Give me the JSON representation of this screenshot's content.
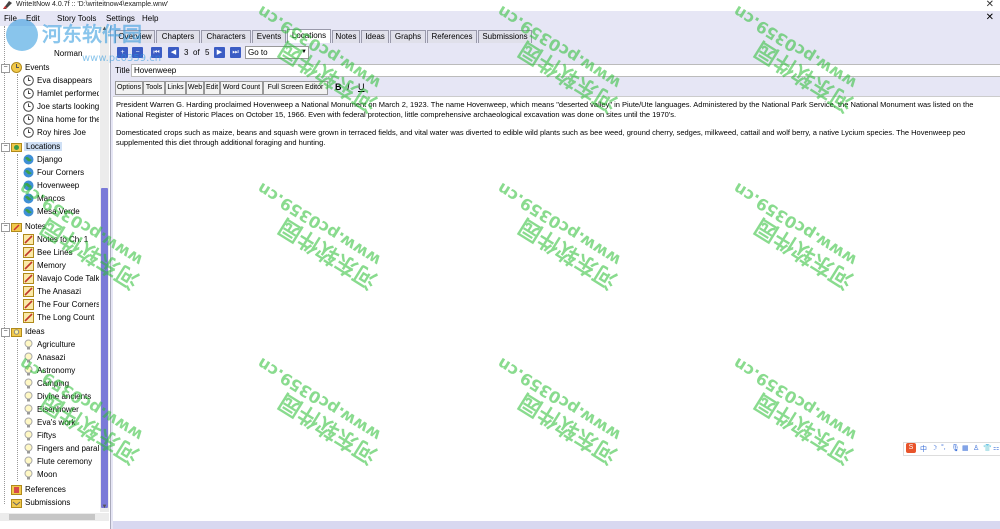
{
  "window": {
    "title": "WriteItNow 4.0.7f :: 'D:\\writeitnow4\\example.wnw'"
  },
  "menu": {
    "items": [
      "File",
      "Edit",
      "Story Tools",
      "Settings",
      "Help"
    ]
  },
  "tree": {
    "partial_top_label": "Norman",
    "events_label": "Events",
    "events": [
      "Eva disappears",
      "Hamlet performed",
      "Joe starts looking",
      "Nina home for the",
      "Roy hires Joe"
    ],
    "locations_label": "Locations",
    "locations": [
      "Django",
      "Four Corners",
      "Hovenweep",
      "Mancos",
      "Mesa Verde"
    ],
    "notes_label": "Notes",
    "notes": [
      "Notes to Ch. 1",
      "Bee Lines",
      "Memory",
      "Navajo Code Talke",
      "The Anasazi",
      "The Four Corners",
      "The Long Count"
    ],
    "ideas_label": "Ideas",
    "ideas": [
      "Agriculture",
      "Anasazi",
      "Astronomy",
      "Camping",
      "Divine ancients",
      "Eisenhower",
      "Eva's work",
      "Fiftys",
      "Fingers and paral",
      "Flute ceremony",
      "Moon"
    ],
    "references_label": "References",
    "submissions_label": "Submissions"
  },
  "tabs": [
    "Overview",
    "Chapters",
    "Characters",
    "Events",
    "Locations",
    "Notes",
    "Ideas",
    "Graphs",
    "References",
    "Submissions"
  ],
  "active_tab": "Locations",
  "nav": {
    "current": "3",
    "of_label": "of",
    "total": "5",
    "goto_label": "Go to"
  },
  "record": {
    "title_label": "Title",
    "title_value": "Hovenweep"
  },
  "toolbar": {
    "buttons": [
      "Options",
      "Tools",
      "Links",
      "Web",
      "Edit",
      "Word Count",
      "Full Screen Editor"
    ],
    "bold": "B",
    "italic": "I",
    "underline": "U"
  },
  "editor": {
    "lines": [
      "President Warren G. Harding proclaimed Hovenweep a National Monument on March 2, 1923. The name Hovenweep, which means \"deserted valley\" in Piute/Ute languages. Administered by the National Park Service, the National Monument was listed on the",
      "National Register of Historic Places on October 15, 1966. Even with federal protection, little comprehensive archaeological excavation was done on sites until the 1970's.",
      "",
      "Domesticated crops such as maize, beans and squash were grown in terraced fields, and vital water was diverted to edible wild plants such as bee weed, ground cherry, sedges, milkweed, cattail and wolf berry, a native Lycium species. The Hovenweep peo",
      "supplemented this diet through additional foraging and hunting."
    ]
  },
  "ime": {
    "logo": "S",
    "glyphs": [
      "中",
      "☽",
      "°,",
      "🎙",
      "▦",
      "♙",
      "👕",
      "⚏"
    ]
  },
  "watermark": {
    "line1": "www.pc0359.cn",
    "line2": "河东软件园"
  },
  "colors": {
    "accent": "#3b5cc4",
    "selection": "#cfe0f5",
    "chrome": "#e6e6f5",
    "watermark": "#28be32"
  }
}
